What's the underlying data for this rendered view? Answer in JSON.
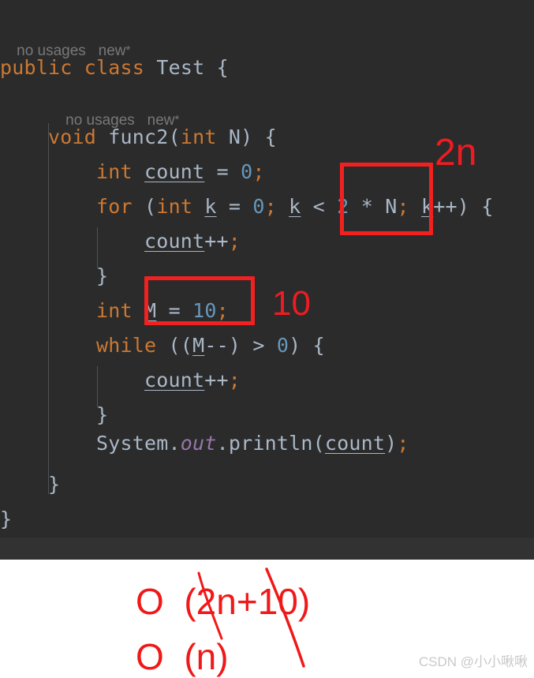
{
  "editor": {
    "theme_background": "#2b2b2b",
    "gutter_strip_color": "#323232",
    "code_vision_hints": [
      {
        "usages": "no usages",
        "author": "new",
        "modified_marker": "*"
      },
      {
        "usages": "no usages",
        "author": "new",
        "modified_marker": "*"
      }
    ],
    "lines": [
      {
        "id": "class-decl",
        "tokens": [
          {
            "t": "public",
            "k": "kw"
          },
          {
            "t": " ",
            "k": "pln"
          },
          {
            "t": "class",
            "k": "kw"
          },
          {
            "t": " ",
            "k": "pln"
          },
          {
            "t": "Test",
            "k": "cls"
          },
          {
            "t": " ",
            "k": "pln"
          },
          {
            "t": "{",
            "k": "brc"
          }
        ]
      },
      {
        "id": "method-decl",
        "tokens": [
          {
            "t": "    ",
            "k": "pln"
          },
          {
            "t": "void",
            "k": "kw"
          },
          {
            "t": " ",
            "k": "pln"
          },
          {
            "t": "func2",
            "k": "fn"
          },
          {
            "t": "(",
            "k": "brc"
          },
          {
            "t": "int",
            "k": "kw"
          },
          {
            "t": " ",
            "k": "pln"
          },
          {
            "t": "N",
            "k": "pln"
          },
          {
            "t": ")",
            "k": "brc"
          },
          {
            "t": " ",
            "k": "pln"
          },
          {
            "t": "{",
            "k": "brc"
          }
        ]
      },
      {
        "id": "count-decl",
        "tokens": [
          {
            "t": "        ",
            "k": "pln"
          },
          {
            "t": "int",
            "k": "kw"
          },
          {
            "t": " ",
            "k": "pln"
          },
          {
            "t": "count",
            "k": "var"
          },
          {
            "t": " = ",
            "k": "pln"
          },
          {
            "t": "0",
            "k": "num"
          },
          {
            "t": ";",
            "k": "op"
          }
        ]
      },
      {
        "id": "for-stmt",
        "tokens": [
          {
            "t": "        ",
            "k": "pln"
          },
          {
            "t": "for",
            "k": "kw"
          },
          {
            "t": " ",
            "k": "pln"
          },
          {
            "t": "(",
            "k": "brc"
          },
          {
            "t": "int",
            "k": "kw"
          },
          {
            "t": " ",
            "k": "pln"
          },
          {
            "t": "k",
            "k": "var"
          },
          {
            "t": " = ",
            "k": "pln"
          },
          {
            "t": "0",
            "k": "num"
          },
          {
            "t": "; ",
            "k": "op"
          },
          {
            "t": "k",
            "k": "var"
          },
          {
            "t": " < ",
            "k": "pln"
          },
          {
            "t": "2",
            "k": "num"
          },
          {
            "t": " * ",
            "k": "pln"
          },
          {
            "t": "N",
            "k": "pln"
          },
          {
            "t": "; ",
            "k": "op"
          },
          {
            "t": "k",
            "k": "var"
          },
          {
            "t": "++",
            "k": "pln"
          },
          {
            "t": ")",
            "k": "brc"
          },
          {
            "t": " ",
            "k": "pln"
          },
          {
            "t": "{",
            "k": "brc"
          }
        ]
      },
      {
        "id": "for-body",
        "tokens": [
          {
            "t": "            ",
            "k": "pln"
          },
          {
            "t": "count",
            "k": "var"
          },
          {
            "t": "++",
            "k": "pln"
          },
          {
            "t": ";",
            "k": "op"
          }
        ]
      },
      {
        "id": "for-close",
        "tokens": [
          {
            "t": "        ",
            "k": "pln"
          },
          {
            "t": "}",
            "k": "brc"
          }
        ]
      },
      {
        "id": "m-decl",
        "tokens": [
          {
            "t": "        ",
            "k": "pln"
          },
          {
            "t": "int",
            "k": "kw"
          },
          {
            "t": " ",
            "k": "pln"
          },
          {
            "t": "M",
            "k": "var"
          },
          {
            "t": " = ",
            "k": "pln"
          },
          {
            "t": "10",
            "k": "num"
          },
          {
            "t": ";",
            "k": "op"
          }
        ]
      },
      {
        "id": "while-stmt",
        "tokens": [
          {
            "t": "        ",
            "k": "pln"
          },
          {
            "t": "while",
            "k": "kw"
          },
          {
            "t": " ",
            "k": "pln"
          },
          {
            "t": "((",
            "k": "brc"
          },
          {
            "t": "M",
            "k": "var"
          },
          {
            "t": "--",
            "k": "pln"
          },
          {
            "t": ")",
            "k": "brc"
          },
          {
            "t": " > ",
            "k": "pln"
          },
          {
            "t": "0",
            "k": "num"
          },
          {
            "t": ")",
            "k": "brc"
          },
          {
            "t": " ",
            "k": "pln"
          },
          {
            "t": "{",
            "k": "brc"
          }
        ]
      },
      {
        "id": "while-body",
        "tokens": [
          {
            "t": "            ",
            "k": "pln"
          },
          {
            "t": "count",
            "k": "var"
          },
          {
            "t": "++",
            "k": "pln"
          },
          {
            "t": ";",
            "k": "op"
          }
        ]
      },
      {
        "id": "while-close",
        "tokens": [
          {
            "t": "        ",
            "k": "pln"
          },
          {
            "t": "}",
            "k": "brc"
          }
        ]
      },
      {
        "id": "println-stmt",
        "tokens": [
          {
            "t": "        ",
            "k": "pln"
          },
          {
            "t": "System",
            "k": "cls"
          },
          {
            "t": ".",
            "k": "pln"
          },
          {
            "t": "out",
            "k": "stat"
          },
          {
            "t": ".",
            "k": "pln"
          },
          {
            "t": "println",
            "k": "fn"
          },
          {
            "t": "(",
            "k": "brc"
          },
          {
            "t": "count",
            "k": "var"
          },
          {
            "t": ")",
            "k": "brc"
          },
          {
            "t": ";",
            "k": "op"
          }
        ]
      },
      {
        "id": "method-close",
        "tokens": [
          {
            "t": "    ",
            "k": "pln"
          },
          {
            "t": "}",
            "k": "brc"
          }
        ]
      },
      {
        "id": "class-close",
        "tokens": [
          {
            "t": "}",
            "k": "brc"
          }
        ]
      }
    ]
  },
  "annotations": {
    "color": "#f32020",
    "box_for_expression_label": "2n",
    "box_m_value_label": "10",
    "notes": [
      {
        "id": "note-complexity-raw",
        "text": "O  (2n+10)",
        "struck_out": true
      },
      {
        "id": "note-complexity-final",
        "text": "O  (n)",
        "struck_out": false
      }
    ]
  },
  "watermark": {
    "text": "CSDN @小小啾啾"
  }
}
